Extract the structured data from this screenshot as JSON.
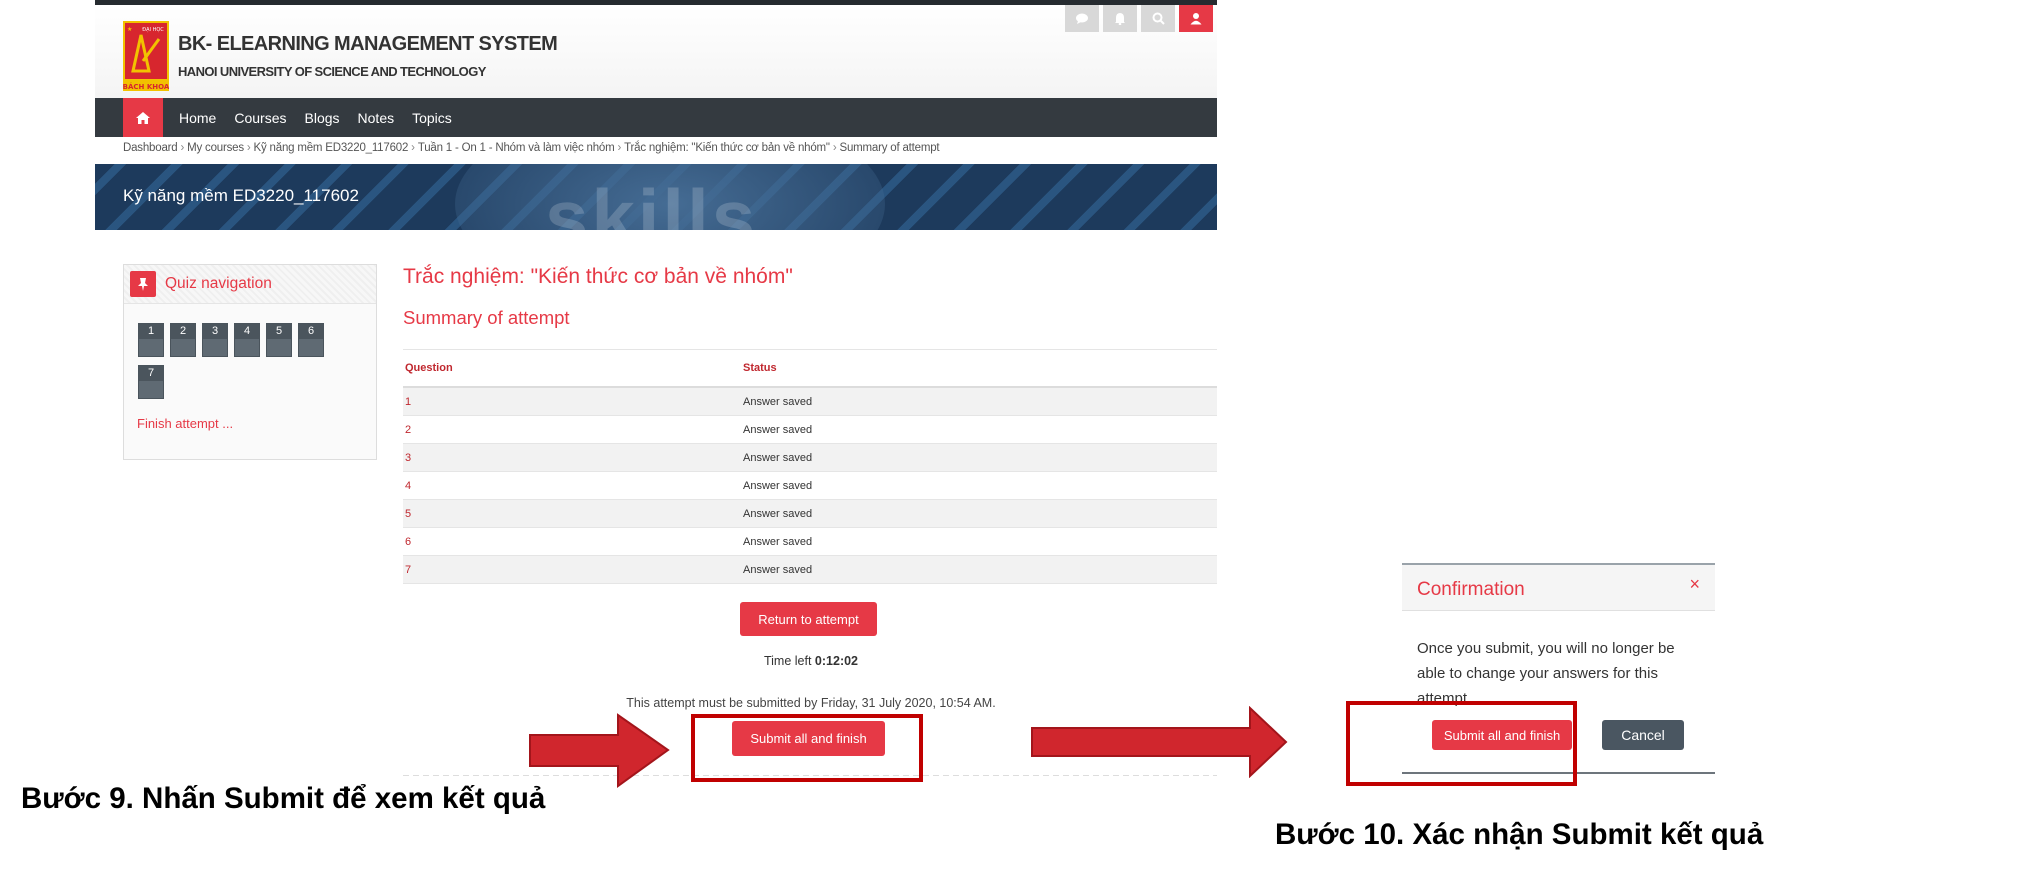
{
  "screen1": {
    "site": {
      "title": "BK- ELEARNING MANAGEMENT SYSTEM",
      "subtitle": "HANOI UNIVERSITY OF SCIENCE AND TECHNOLOGY",
      "logo_text_top": "ĐẠI HỌC",
      "logo_text_bottom": "BÁCH KHOA"
    },
    "top_icons": [
      "comment-icon",
      "bell-icon",
      "search-icon",
      "user-icon"
    ],
    "nav": {
      "items": [
        "Home",
        "Courses",
        "Blogs",
        "Notes",
        "Topics"
      ]
    },
    "breadcrumb": [
      "Dashboard",
      "My courses",
      "Kỹ năng mềm ED3220_117602",
      "Tuần 1 - On 1 - Nhóm và làm việc nhóm",
      "Trắc nghiệm: \"Kiến thức cơ bản về nhóm\"",
      "Summary of attempt"
    ],
    "banner": {
      "course_title": "Kỹ năng mềm ED3220_117602",
      "background_word": "skills"
    },
    "quiz_navigation": {
      "title": "Quiz navigation",
      "questions": [
        "1",
        "2",
        "3",
        "4",
        "5",
        "6",
        "7"
      ],
      "finish_link": "Finish attempt ..."
    },
    "main": {
      "quiz_title": "Trắc nghiệm: \"Kiến thức cơ bản về nhóm\"",
      "summary_title": "Summary of attempt",
      "table": {
        "headers": [
          "Question",
          "Status"
        ],
        "rows": [
          [
            "1",
            "Answer saved"
          ],
          [
            "2",
            "Answer saved"
          ],
          [
            "3",
            "Answer saved"
          ],
          [
            "4",
            "Answer saved"
          ],
          [
            "5",
            "Answer saved"
          ],
          [
            "6",
            "Answer saved"
          ],
          [
            "7",
            "Answer saved"
          ]
        ]
      },
      "return_button": "Return to attempt",
      "time_left_label": "Time left",
      "time_left_value": "0:12:02",
      "deadline_note": "This attempt must be submitted by Friday, 31 July 2020, 10:54 AM.",
      "submit_button": "Submit all and finish"
    }
  },
  "screen2": {
    "dialog": {
      "title": "Confirmation",
      "close_glyph": "×",
      "message": "Once you submit, you will no longer be able to change your answers for this attempt.",
      "submit_button": "Submit all and finish",
      "cancel_button": "Cancel"
    }
  },
  "captions": {
    "step9": "Bước 9. Nhấn Submit để xem kết quả",
    "step10": "Bước 10. Xác nhận Submit kết quả"
  },
  "colors": {
    "accent": "#e63946",
    "navbar": "#343a40",
    "highlight": "#c00000",
    "arrow": "#d0262d"
  }
}
